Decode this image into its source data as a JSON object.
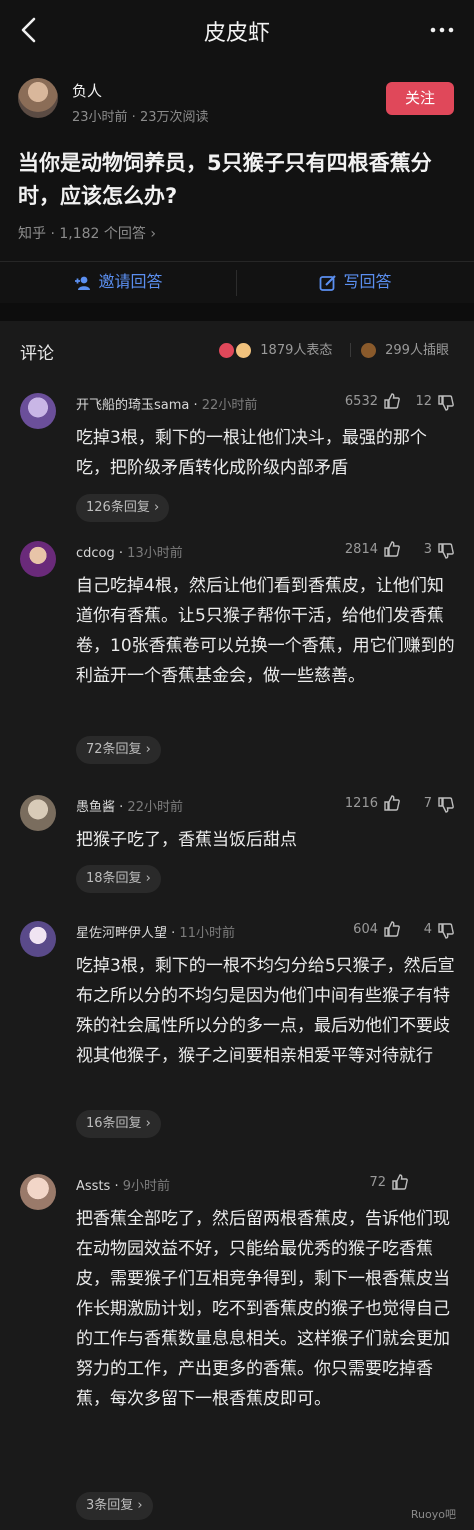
{
  "header": {
    "title": "皮皮虾"
  },
  "author": {
    "name": "负人",
    "meta": "23小时前 · 23万次阅读",
    "follow_label": "关注"
  },
  "question": {
    "title": "当你是动物饲养员，5只猴子只有四根香蕉分时，应该怎么办?",
    "meta": "知乎 · 1,182 个回答 ›"
  },
  "actions": {
    "invite_label": "邀请回答",
    "write_label": "写回答"
  },
  "comments_header": {
    "label": "评论",
    "reactions": "1879人表态",
    "tips": "299人插眼"
  },
  "comments": [
    {
      "name": "开飞船的琦玉sama",
      "time": "22小时前",
      "likes": "6532",
      "dislikes": "12",
      "text": "吃掉3根，剩下的一根让他们决斗，最强的那个吃，把阶级矛盾转化成阶级内部矛盾",
      "replies": "126条回复 ›"
    },
    {
      "name": "cdcog",
      "time": "13小时前",
      "likes": "2814",
      "dislikes": "3",
      "text": "自己吃掉4根，然后让他们看到香蕉皮，让他们知道你有香蕉。让5只猴子帮你干活，给他们发香蕉卷，10张香蕉卷可以兑换一个香蕉，用它们赚到的利益开一个香蕉基金会，做一些慈善。",
      "replies": "72条回复 ›"
    },
    {
      "name": "愚鱼酱",
      "time": "22小时前",
      "likes": "1216",
      "dislikes": "7",
      "text": "把猴子吃了，香蕉当饭后甜点",
      "replies": "18条回复 ›"
    },
    {
      "name": "星佐河畔伊人望",
      "time": "11小时前",
      "likes": "604",
      "dislikes": "4",
      "text": "吃掉3根，剩下的一根不均匀分给5只猴子，然后宣布之所以分的不均匀是因为他们中间有些猴子有特殊的社会属性所以分的多一点，最后劝他们不要歧视其他猴子，猴子之间要相亲相爱平等对待就行",
      "replies": "16条回复 ›"
    },
    {
      "name": "Assts",
      "time": "9小时前",
      "likes": "72",
      "dislikes": "",
      "text": "把香蕉全部吃了，然后留两根香蕉皮，告诉他们现在动物园效益不好，只能给最优秀的猴子吃香蕉皮，需要猴子们互相竞争得到，剩下一根香蕉皮当作长期激励计划，吃不到香蕉皮的猴子也觉得自己的工作与香蕉数量息息相关。这样猴子们就会更加努力的工作，产出更多的香蕉。你只需要吃掉香蕉，每次多留下一根香蕉皮即可。",
      "replies": "3条回复 ›"
    }
  ],
  "watermark": "Ruoyo吧",
  "colors": {
    "accent": "#e0485a",
    "link": "#5b8ff0",
    "background": "#161616"
  }
}
